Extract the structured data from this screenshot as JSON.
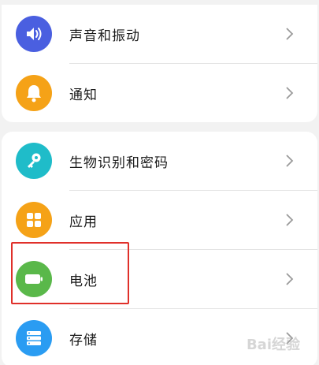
{
  "groups": [
    {
      "items": [
        {
          "label": "声音和振动",
          "icon": "speaker-icon",
          "color": "#4a5fe0"
        },
        {
          "label": "通知",
          "icon": "bell-icon",
          "color": "#f5a217"
        }
      ]
    },
    {
      "items": [
        {
          "label": "生物识别和密码",
          "icon": "key-icon",
          "color": "#1fbcc9"
        },
        {
          "label": "应用",
          "icon": "apps-grid-icon",
          "color": "#f5a217"
        },
        {
          "label": "电池",
          "icon": "battery-icon",
          "color": "#5ab84a"
        },
        {
          "label": "存储",
          "icon": "storage-icon",
          "color": "#2a9cf2"
        }
      ]
    }
  ],
  "highlight_color": "#e0302a",
  "watermark": "Bai经验"
}
